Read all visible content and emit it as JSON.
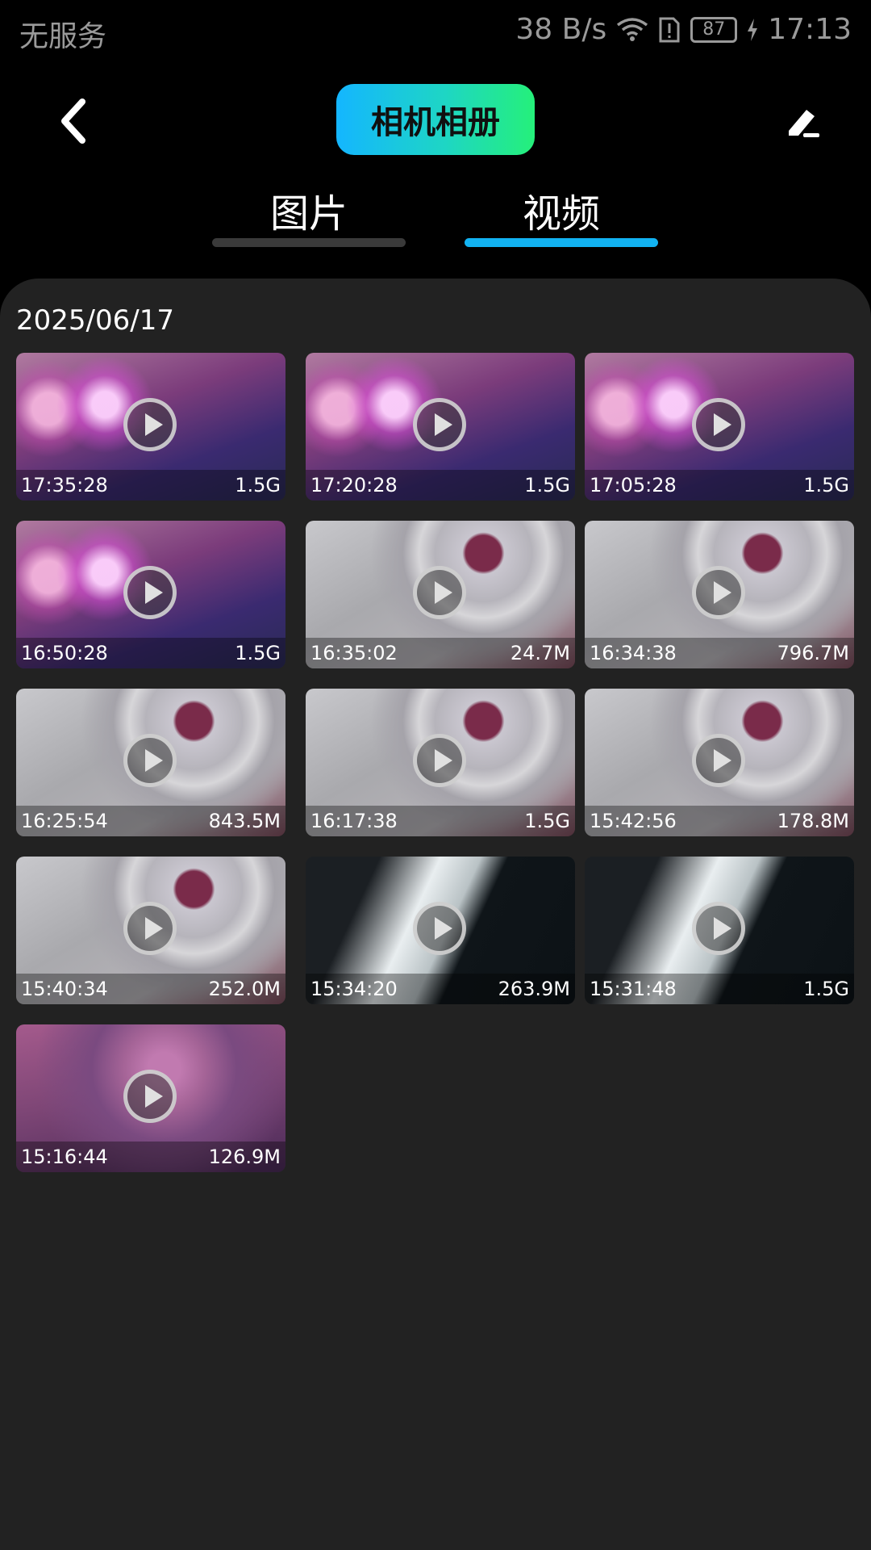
{
  "status_bar": {
    "carrier": "无服务",
    "speed": "38 B/s",
    "battery": "87",
    "time": "17:13"
  },
  "header": {
    "title": "相机相册"
  },
  "tabs": [
    {
      "label": "图片",
      "active": false
    },
    {
      "label": "视频",
      "active": true
    }
  ],
  "section": {
    "date": "2025/06/17"
  },
  "videos": [
    {
      "time": "17:35:28",
      "size": "1.5G",
      "thumb": "purple"
    },
    {
      "time": "17:20:28",
      "size": "1.5G",
      "thumb": "purple"
    },
    {
      "time": "17:05:28",
      "size": "1.5G",
      "thumb": "purple"
    },
    {
      "time": "16:50:28",
      "size": "1.5G",
      "thumb": "purple"
    },
    {
      "time": "16:35:02",
      "size": "24.7M",
      "thumb": "gray"
    },
    {
      "time": "16:34:38",
      "size": "796.7M",
      "thumb": "gray"
    },
    {
      "time": "16:25:54",
      "size": "843.5M",
      "thumb": "gray"
    },
    {
      "time": "16:17:38",
      "size": "1.5G",
      "thumb": "gray"
    },
    {
      "time": "15:42:56",
      "size": "178.8M",
      "thumb": "gray"
    },
    {
      "time": "15:40:34",
      "size": "252.0M",
      "thumb": "gray"
    },
    {
      "time": "15:34:20",
      "size": "263.9M",
      "thumb": "dark"
    },
    {
      "time": "15:31:48",
      "size": "1.5G",
      "thumb": "dark"
    },
    {
      "time": "15:16:44",
      "size": "126.9M",
      "thumb": "pink"
    }
  ],
  "colors": {
    "accent": "#12b3f2",
    "panel": "#222222",
    "title_gradient_start": "#14b6ff",
    "title_gradient_end": "#25f07a"
  }
}
